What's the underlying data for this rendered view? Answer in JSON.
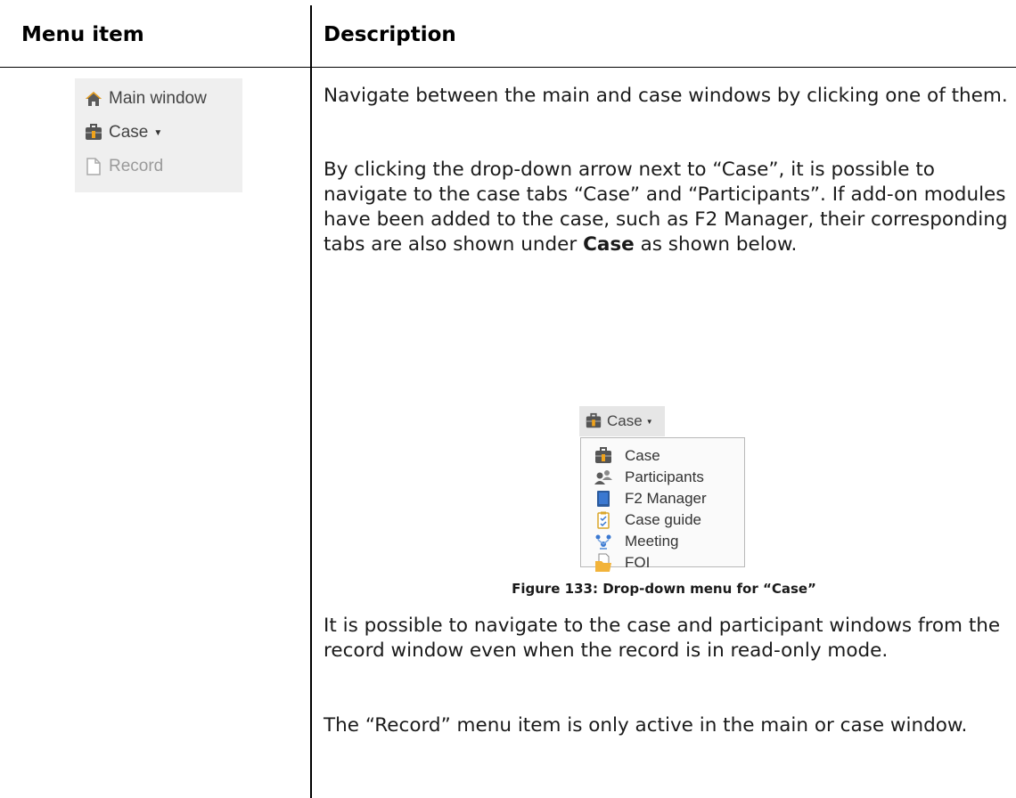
{
  "table": {
    "header_col1": "Menu item",
    "header_col2": "Description"
  },
  "ribbon": {
    "items": [
      {
        "label": "Main window",
        "icon": "home-icon"
      },
      {
        "label": "Case",
        "icon": "case-icon"
      },
      {
        "label": "Record",
        "icon": "document-icon"
      }
    ]
  },
  "description": {
    "p1": "Navigate between the main and case windows by clicking one of them.",
    "p2_text": "By clicking the drop-down arrow next to “Case”, it is possible to navigate to the case tabs “Case” and “Participants”. If add-on modules have been added to the case, such as F2 Manager, their corresponding tabs are also shown under",
    "p2_bold": "Case",
    "p2_end": "as shown below.",
    "p3": "It is possible to navigate to the case and participant windows from the record window even when the record is in read-only mode.",
    "p4": "The “Record” menu item is only active in the main or case window."
  },
  "figure": {
    "button_label": "Case",
    "menu_items": [
      "Case",
      "Participants",
      "F2 Manager",
      "Case guide",
      "Meeting",
      "FOI"
    ],
    "caption": "Figure 133: Drop-down menu for “Case”"
  }
}
